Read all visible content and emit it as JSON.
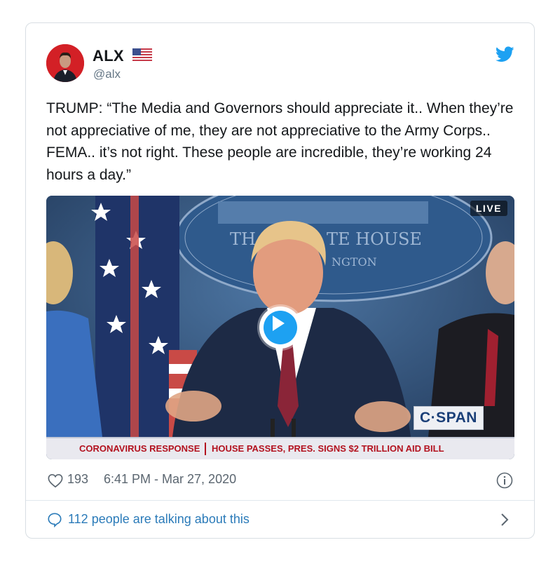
{
  "tweet": {
    "display_name": "ALX",
    "handle": "@alx",
    "text": "TRUMP: “The Media and Governors should appreciate it.. When they’re not appreciative of me, they are not appreciative to the Army Corps.. FEMA.. it’s not right. These people are incredible, they’re working 24 hours a day.”",
    "like_count": "193",
    "timestamp": "6:41 PM - Mar 27, 2020",
    "conversation_link": "112 people are talking about this"
  },
  "video": {
    "live_label": "LIVE",
    "backdrop_text_left": "TH",
    "backdrop_text_right": "TE HOUSE",
    "backdrop_subtext": "NGTON",
    "network_logo": "C·SPAN",
    "ticker_left": "CORONAVIRUS RESPONSE",
    "ticker_right": "HOUSE PASSES, PRES. SIGNS $2 TRILLION AID BILL"
  },
  "icons": {
    "brand": "twitter-bird-icon",
    "flag": "us-flag-emoji",
    "like": "heart-outline-icon",
    "info": "info-circle-icon",
    "reply": "speech-bubble-icon",
    "chevron": "chevron-right-icon"
  },
  "colors": {
    "brand_blue": "#1da1f2",
    "link_blue": "#2b7bb9",
    "avatar_red": "#d32026",
    "ticker_red": "#b3121f"
  }
}
